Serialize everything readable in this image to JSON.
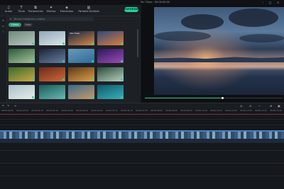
{
  "menu": {
    "items": [
      "Archivo",
      "Editar",
      "Herramientas",
      "Ver",
      "Exportar",
      "Ayuda"
    ],
    "window_title": "Sin Título : 00:00:00:00"
  },
  "toolbar": {
    "tools": [
      {
        "label": "Audio",
        "icon": "music-icon"
      },
      {
        "label": "Título",
        "icon": "title-icon"
      },
      {
        "label": "Transiciones",
        "icon": "transition-icon"
      },
      {
        "label": "Efectos",
        "icon": "effects-icon"
      },
      {
        "label": "Elementos",
        "icon": "elements-icon"
      },
      {
        "label": "Pantalla Dividida",
        "icon": "split-screen-icon"
      }
    ],
    "export_label": "EXPORTAR"
  },
  "media": {
    "search_placeholder": "Buscar imágenes y videos",
    "chips": {
      "active": "Videos",
      "idle": "Fotos"
    },
    "thumbs": [
      {
        "color1": "#6f8a7a",
        "color2": "#b9c7c1"
      },
      {
        "color1": "#8fa8b8",
        "color2": "#dfe6ea"
      },
      {
        "color1": "#0f2340",
        "color2": "#d98a4a",
        "caption": "Star Trails"
      },
      {
        "color1": "#2e4a7a",
        "color2": "#e07b3f"
      },
      {
        "color1": "#2a5a3a",
        "color2": "#a8c49a"
      },
      {
        "color1": "#1a2438",
        "color2": "#6a7fa0"
      },
      {
        "color1": "#6a9ab8",
        "color2": "#2e6a9a"
      },
      {
        "color1": "#2a1a5a",
        "color2": "#a04ab8"
      },
      {
        "color1": "#3a6a2a",
        "color2": "#c9a84a"
      },
      {
        "color1": "#6a2a1a",
        "color2": "#d06a3a"
      },
      {
        "color1": "#5a3a1a",
        "color2": "#e0a04a"
      },
      {
        "color1": "#2a4a3a",
        "color2": "#b8d0c0"
      },
      {
        "color1": "#a8c0c8",
        "color2": "#e8ece8"
      },
      {
        "color1": "#1a5a5a",
        "color2": "#6ab8b0"
      },
      {
        "color1": "#3a6a8a",
        "color2": "#c89a6a"
      },
      {
        "color1": "#0e5a6a",
        "color2": "#3ab0b8"
      }
    ]
  },
  "player": {
    "progress": 0.56,
    "quality_label": "Completo"
  },
  "timeline": {
    "ticks": [
      "00:00:00:00",
      "00:00:00:20",
      "00:00:01:15",
      "00:00:02:10",
      "00:00:03:05",
      "00:00:04:00",
      "00:00:04:20",
      "00:00:05:15",
      "00:00:06:10",
      "00:00:07:05",
      "00:00:08:00",
      "00:00:08:20",
      "00:00:09:15",
      "00:00:10:10",
      "00:00:11:05",
      "00:00:12:00",
      "00:00:12:20",
      "00:00:13:15",
      "00:00:14:10"
    ]
  },
  "colors": {
    "accent": "#27d39a",
    "playhead": "#e04848"
  }
}
